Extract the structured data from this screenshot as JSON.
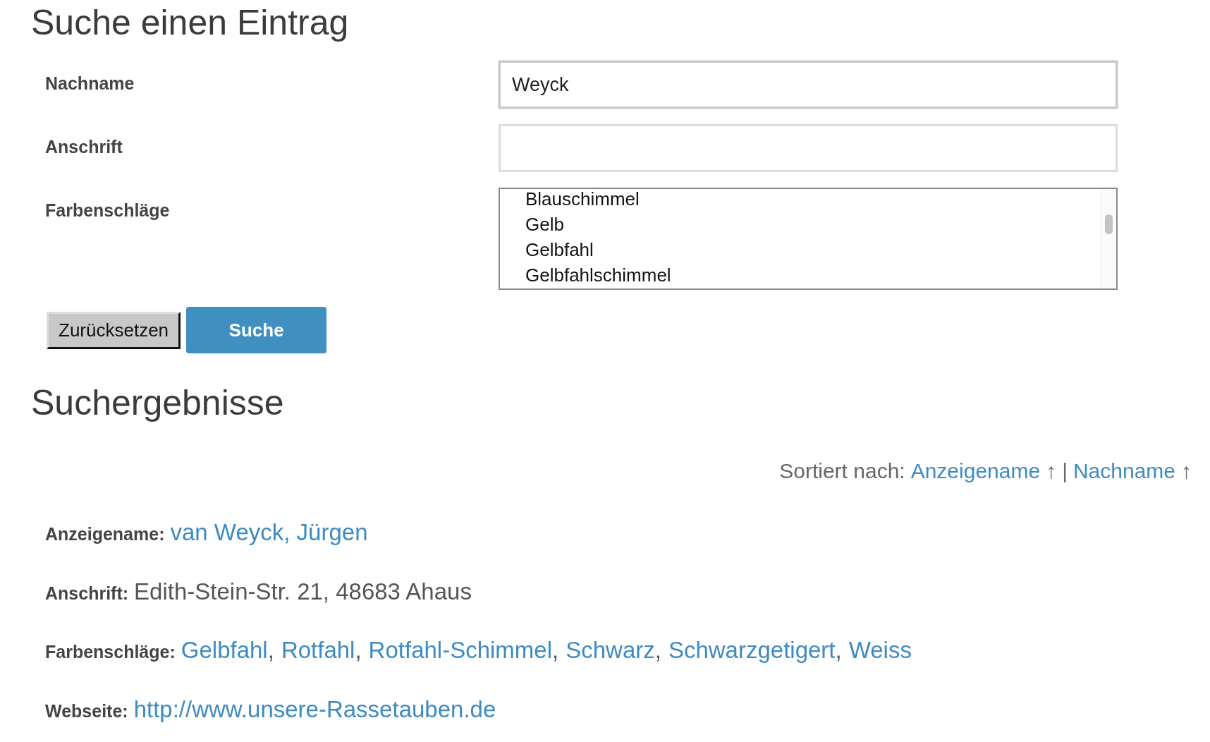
{
  "search_form": {
    "title": "Suche einen Eintrag",
    "fields": [
      {
        "kind": "text",
        "label": "Nachname",
        "value": "Weyck",
        "focused": true
      },
      {
        "kind": "text",
        "label": "Anschrift",
        "focused": false
      },
      {
        "kind": "listbox",
        "label": "Farbenschläge",
        "options": [
          {
            "label": "Blauschimmel",
            "selected": false
          },
          {
            "label": "Gelb",
            "selected": false
          },
          {
            "label": "Gelbfahl",
            "selected": false
          },
          {
            "label": "Gelbfahlschimmel",
            "selected": false
          }
        ]
      }
    ],
    "buttons": [
      {
        "kind": "reset",
        "label": "Zurücksetzen"
      },
      {
        "kind": "submit",
        "label": "Suche"
      }
    ]
  },
  "results": {
    "title": "Suchergebnisse",
    "sort": {
      "label": "Sortiert nach:",
      "separator": "|",
      "links": [
        {
          "label": "Anzeigename",
          "arrow": "↑"
        },
        {
          "label": "Nachname",
          "arrow": "↑"
        }
      ]
    },
    "entries": [
      {
        "fields": [
          {
            "kind": "link",
            "label": "Anzeigename:",
            "value": "van Weyck, Jürgen"
          },
          {
            "kind": "text",
            "label": "Anschrift:",
            "value": "Edith-Stein-Str. 21, 48683 Ahaus"
          },
          {
            "kind": "links",
            "label": "Farbenschläge:",
            "separator": ",",
            "values": [
              "Gelbfahl",
              "Rotfahl",
              "Rotfahl-Schimmel",
              "Schwarz",
              "Schwarzgetigert",
              "Weiss"
            ]
          },
          {
            "kind": "link",
            "label": "Webseite:",
            "value": "http://www.unsere-Rassetauben.de"
          }
        ]
      }
    ]
  }
}
